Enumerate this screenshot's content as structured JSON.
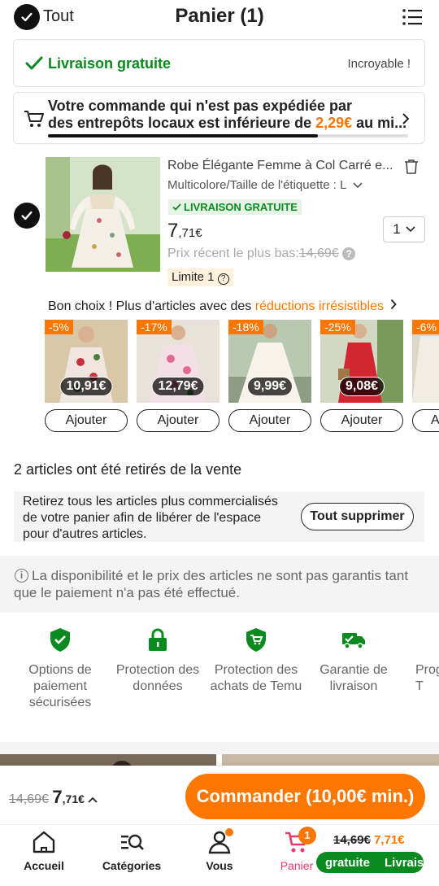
{
  "header": {
    "select_all_label": "Tout",
    "title": "Panier (1)",
    "menu_icon": "list-icon"
  },
  "free_shipping": {
    "label": "Livraison gratuite",
    "note": "Incroyable !"
  },
  "local_warehouse": {
    "text_part1": "Votre commande qui n'est pas expédiée par",
    "text_part2": "des entrepôts locaux est inférieure de ",
    "amount": "2,29€",
    "text_part3": " au mi...",
    "progress": 0.75
  },
  "cart_item": {
    "title": "Robe Élégante Femme à Col Carré e...",
    "variant": "Multicolore/Taille de l'étiquette : L",
    "shipping_badge": "LIVRAISON GRATUITE",
    "price_int": "7",
    "price_dec": ",71€",
    "recent_low_label": "Prix récent le plus bas:",
    "recent_low_price": "14,69€",
    "limit_label": "Limite 1",
    "quantity": "1"
  },
  "recommendations": {
    "heading_part1": "Bon choix ! Plus d'articles avec des ",
    "heading_highlight": "réductions irrésistibles",
    "items": [
      {
        "discount": "-5%",
        "price": "10,91€",
        "button": "Ajouter"
      },
      {
        "discount": "-17%",
        "price": "12,79€",
        "button": "Ajouter"
      },
      {
        "discount": "-18%",
        "price": "9,99€",
        "button": "Ajouter"
      },
      {
        "discount": "-25%",
        "price": "9,08€",
        "button": "Ajouter"
      },
      {
        "discount": "-6%",
        "price": "",
        "button": "A"
      }
    ]
  },
  "removed": {
    "heading": "2 articles ont été retirés de la vente",
    "description": "Retirez tous les articles plus commercialisés de votre panier afin de libérer de l'espace pour d'autres articles.",
    "delete_all_button": "Tout supprimer"
  },
  "disclaimer": "La disponibilité et le prix des articles ne sont pas garantis tant que le paiement n'a pas été effectué.",
  "trust_badges": [
    {
      "label": "Options de paiement sécurisées"
    },
    {
      "label": "Protection des données"
    },
    {
      "label": "Protection des achats de Temu"
    },
    {
      "label": "Garantie de livraison"
    },
    {
      "label": "Prog de p d'ar T"
    }
  ],
  "checkout": {
    "old_price": "14,69€",
    "price_int": "7",
    "price_dec": ",71€",
    "button_label": "Commander (10,00€ min.)"
  },
  "bottom_nav": {
    "home": "Accueil",
    "categories": "Catégories",
    "account": "Vous",
    "cart": "Panier",
    "cart_count": "1",
    "cart_old_price": "14,69€",
    "cart_new_price": "7,71€",
    "cart_pill_1": "gratuite",
    "cart_pill_2": "Livrais"
  },
  "colors": {
    "accent": "#fb7701",
    "green": "#0a8a1f"
  }
}
